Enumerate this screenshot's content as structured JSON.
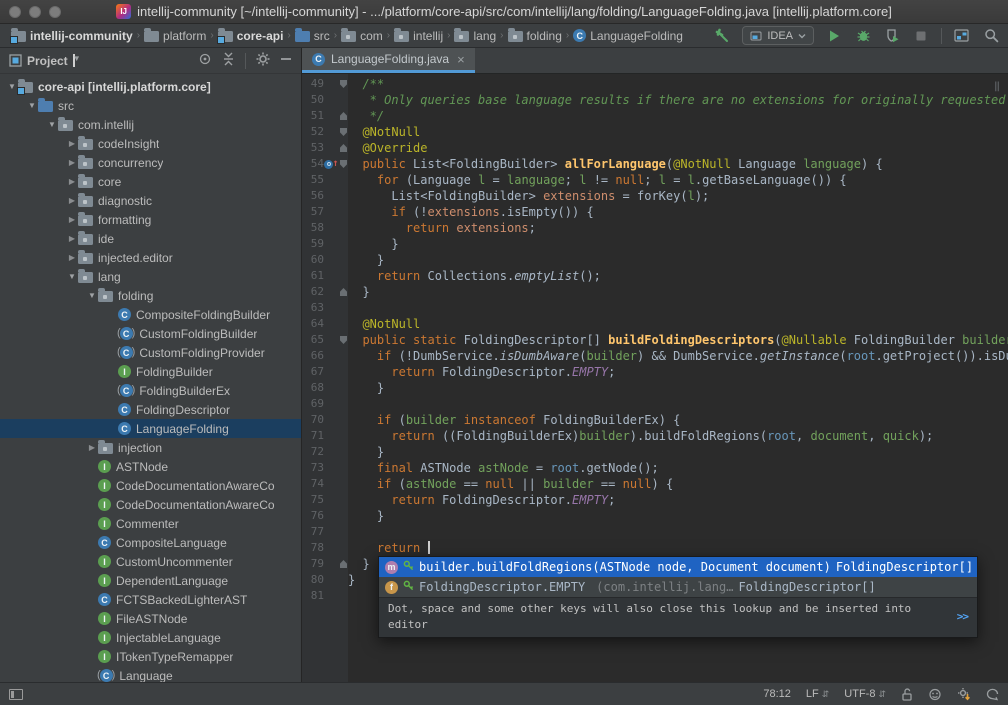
{
  "colors": {
    "editor_bg": "#2b2b2b",
    "panel_bg": "#3c3f41",
    "gutter_bg": "#313335",
    "tab_underline": "#529ad6",
    "tree_selection": "#1b3e5f",
    "popup_selection": "#1f63c2",
    "keyword": "#cc7832",
    "annotation": "#bbb529",
    "comment": "#629755",
    "method_decl": "#ffc66d",
    "run_green": "#59a869"
  },
  "title_bar": {
    "title": "intellij-community [~/intellij-community] - .../platform/core-api/src/com/intellij/lang/folding/LanguageFolding.java [intellij.platform.core]"
  },
  "toolbar": {
    "breadcrumbs": [
      {
        "label": "intellij-community",
        "icon": "module",
        "bold": true
      },
      {
        "label": "platform",
        "icon": "folder"
      },
      {
        "label": "core-api",
        "icon": "module",
        "bold": true
      },
      {
        "label": "src",
        "icon": "folder-src"
      },
      {
        "label": "com",
        "icon": "package"
      },
      {
        "label": "intellij",
        "icon": "package"
      },
      {
        "label": "lang",
        "icon": "package"
      },
      {
        "label": "folding",
        "icon": "package"
      },
      {
        "label": "LanguageFolding",
        "icon": "class"
      }
    ],
    "run_config": "IDEA",
    "action_icons": [
      "build-hammer",
      "run",
      "debug",
      "run-with-coverage",
      "stop",
      "project-structure",
      "search"
    ]
  },
  "project_panel": {
    "header": {
      "title": "Project",
      "icons": [
        "locate",
        "collapse-all",
        "settings-gear",
        "hide"
      ]
    },
    "tree": [
      {
        "label": "core-api [intellij.platform.core]",
        "level": 0,
        "icon": "module",
        "expand": "open",
        "bold": true
      },
      {
        "label": "src",
        "level": 1,
        "icon": "folder-src",
        "expand": "open"
      },
      {
        "label": "com.intellij",
        "level": 2,
        "icon": "package",
        "expand": "open"
      },
      {
        "label": "codeInsight",
        "level": 3,
        "icon": "package",
        "expand": "closed"
      },
      {
        "label": "concurrency",
        "level": 3,
        "icon": "package",
        "expand": "closed"
      },
      {
        "label": "core",
        "level": 3,
        "icon": "package",
        "expand": "closed"
      },
      {
        "label": "diagnostic",
        "level": 3,
        "icon": "package",
        "expand": "closed"
      },
      {
        "label": "formatting",
        "level": 3,
        "icon": "package",
        "expand": "closed"
      },
      {
        "label": "ide",
        "level": 3,
        "icon": "package",
        "expand": "closed"
      },
      {
        "label": "injected.editor",
        "level": 3,
        "icon": "package",
        "expand": "closed"
      },
      {
        "label": "lang",
        "level": 3,
        "icon": "package",
        "expand": "open"
      },
      {
        "label": "folding",
        "level": 4,
        "icon": "package",
        "expand": "open"
      },
      {
        "label": "CompositeFoldingBuilder",
        "level": 5,
        "icon": "class"
      },
      {
        "label": "CustomFoldingBuilder",
        "level": 5,
        "icon": "class-abstract"
      },
      {
        "label": "CustomFoldingProvider",
        "level": 5,
        "icon": "class-abstract"
      },
      {
        "label": "FoldingBuilder",
        "level": 5,
        "icon": "interface"
      },
      {
        "label": "FoldingBuilderEx",
        "level": 5,
        "icon": "class-abstract"
      },
      {
        "label": "FoldingDescriptor",
        "level": 5,
        "icon": "class"
      },
      {
        "label": "LanguageFolding",
        "level": 5,
        "icon": "class",
        "selected": true
      },
      {
        "label": "injection",
        "level": 4,
        "icon": "package",
        "expand": "closed"
      },
      {
        "label": "ASTNode",
        "level": 4,
        "icon": "interface"
      },
      {
        "label": "CodeDocumentationAwareCo",
        "level": 4,
        "icon": "interface"
      },
      {
        "label": "CodeDocumentationAwareCo",
        "level": 4,
        "icon": "interface"
      },
      {
        "label": "Commenter",
        "level": 4,
        "icon": "interface"
      },
      {
        "label": "CompositeLanguage",
        "level": 4,
        "icon": "class"
      },
      {
        "label": "CustomUncommenter",
        "level": 4,
        "icon": "interface"
      },
      {
        "label": "DependentLanguage",
        "level": 4,
        "icon": "interface"
      },
      {
        "label": "FCTSBackedLighterAST",
        "level": 4,
        "icon": "class"
      },
      {
        "label": "FileASTNode",
        "level": 4,
        "icon": "interface"
      },
      {
        "label": "InjectableLanguage",
        "level": 4,
        "icon": "interface"
      },
      {
        "label": "ITokenTypeRemapper",
        "level": 4,
        "icon": "interface"
      },
      {
        "label": "Language",
        "level": 4,
        "icon": "class-abstract"
      }
    ]
  },
  "editor": {
    "tab": {
      "label": "LanguageFolding.java",
      "icon": "class",
      "close": "×"
    },
    "lines": [
      {
        "n": 49,
        "f": "d",
        "s": [
          [
            "  /**",
            "c"
          ]
        ]
      },
      {
        "n": 50,
        "s": [
          [
            "   * Only queries base language results if there are no extensions for originally requested",
            "c"
          ]
        ]
      },
      {
        "n": 51,
        "f": "u",
        "s": [
          [
            "   */",
            "c"
          ]
        ]
      },
      {
        "n": 52,
        "f": "d",
        "s": [
          [
            "  ",
            "p"
          ],
          [
            "@NotNull",
            "a"
          ]
        ]
      },
      {
        "n": 53,
        "f": "u",
        "s": [
          [
            "  ",
            "p"
          ],
          [
            "@Override",
            "a"
          ]
        ]
      },
      {
        "n": 54,
        "f": "d",
        "g": "override",
        "s": [
          [
            "  ",
            "p"
          ],
          [
            "public",
            "k"
          ],
          [
            " List<FoldingBuilder> ",
            "p"
          ],
          [
            "allForLanguage",
            "m"
          ],
          [
            "(",
            "p"
          ],
          [
            "@NotNull",
            "a"
          ],
          [
            " Language ",
            "p"
          ],
          [
            "language",
            "v"
          ],
          [
            ") {",
            "p"
          ]
        ]
      },
      {
        "n": 55,
        "s": [
          [
            "    ",
            "p"
          ],
          [
            "for",
            "k"
          ],
          [
            " (Language ",
            "p"
          ],
          [
            "l",
            "v"
          ],
          [
            " = ",
            "p"
          ],
          [
            "language",
            "v"
          ],
          [
            "; ",
            "p"
          ],
          [
            "l",
            "v"
          ],
          [
            " != ",
            "p"
          ],
          [
            "null",
            "k"
          ],
          [
            "; ",
            "p"
          ],
          [
            "l",
            "v"
          ],
          [
            " = ",
            "p"
          ],
          [
            "l",
            "v"
          ],
          [
            ".getBaseLanguage()) {",
            "p"
          ]
        ]
      },
      {
        "n": 56,
        "s": [
          [
            "      List<FoldingBuilder> ",
            "p"
          ],
          [
            "extensions",
            "s"
          ],
          [
            " = forKey(",
            "p"
          ],
          [
            "l",
            "v"
          ],
          [
            ");",
            "p"
          ]
        ]
      },
      {
        "n": 57,
        "s": [
          [
            "      ",
            "p"
          ],
          [
            "if",
            "k"
          ],
          [
            " (!",
            "p"
          ],
          [
            "extensions",
            "s"
          ],
          [
            ".isEmpty()) {",
            "p"
          ]
        ]
      },
      {
        "n": 58,
        "s": [
          [
            "        ",
            "p"
          ],
          [
            "return",
            "k"
          ],
          [
            " ",
            "p"
          ],
          [
            "extensions",
            "s"
          ],
          [
            ";",
            "p"
          ]
        ]
      },
      {
        "n": 59,
        "s": [
          [
            "      }",
            "p"
          ]
        ]
      },
      {
        "n": 60,
        "s": [
          [
            "    }",
            "p"
          ]
        ]
      },
      {
        "n": 61,
        "s": [
          [
            "    ",
            "p"
          ],
          [
            "return",
            "k"
          ],
          [
            " Collections.",
            "p"
          ],
          [
            "emptyList",
            "i"
          ],
          [
            "();",
            "p"
          ]
        ]
      },
      {
        "n": 62,
        "f": "u",
        "s": [
          [
            "  }",
            "p"
          ]
        ]
      },
      {
        "n": 63,
        "s": []
      },
      {
        "n": 64,
        "s": [
          [
            "  ",
            "p"
          ],
          [
            "@NotNull",
            "a"
          ]
        ]
      },
      {
        "n": 65,
        "f": "d",
        "s": [
          [
            "  ",
            "p"
          ],
          [
            "public",
            "k"
          ],
          [
            " ",
            "p"
          ],
          [
            "static",
            "k"
          ],
          [
            " FoldingDescriptor[] ",
            "p"
          ],
          [
            "buildFoldingDescriptors",
            "m"
          ],
          [
            "(",
            "p"
          ],
          [
            "@Nullable",
            "a"
          ],
          [
            " FoldingBuilder ",
            "p"
          ],
          [
            "builder",
            "v"
          ],
          [
            ", ",
            "p"
          ]
        ]
      },
      {
        "n": 66,
        "s": [
          [
            "    ",
            "p"
          ],
          [
            "if",
            "k"
          ],
          [
            " (!DumbService.",
            "p"
          ],
          [
            "isDumbAware",
            "i"
          ],
          [
            "(",
            "p"
          ],
          [
            "builder",
            "v"
          ],
          [
            ") && DumbService.",
            "p"
          ],
          [
            "getInstance",
            "i"
          ],
          [
            "(",
            "p"
          ],
          [
            "root",
            "b"
          ],
          [
            ".getProject()).isDumb",
            "p"
          ]
        ]
      },
      {
        "n": 67,
        "s": [
          [
            "      ",
            "p"
          ],
          [
            "return",
            "k"
          ],
          [
            " FoldingDescriptor.",
            "p"
          ],
          [
            "EMPTY",
            "e"
          ],
          [
            ";",
            "p"
          ]
        ]
      },
      {
        "n": 68,
        "s": [
          [
            "    }",
            "p"
          ]
        ]
      },
      {
        "n": 69,
        "s": []
      },
      {
        "n": 70,
        "s": [
          [
            "    ",
            "p"
          ],
          [
            "if",
            "k"
          ],
          [
            " (",
            "p"
          ],
          [
            "builder",
            "v"
          ],
          [
            " ",
            "p"
          ],
          [
            "instanceof",
            "k"
          ],
          [
            " FoldingBuilderEx) {",
            "p"
          ]
        ]
      },
      {
        "n": 71,
        "s": [
          [
            "      ",
            "p"
          ],
          [
            "return",
            "k"
          ],
          [
            " ((FoldingBuilderEx)",
            "p"
          ],
          [
            "builder",
            "v"
          ],
          [
            ").buildFoldRegions(",
            "p"
          ],
          [
            "root",
            "b"
          ],
          [
            ", ",
            "p"
          ],
          [
            "document",
            "v"
          ],
          [
            ", ",
            "p"
          ],
          [
            "quick",
            "v"
          ],
          [
            ");",
            "p"
          ]
        ]
      },
      {
        "n": 72,
        "s": [
          [
            "    }",
            "p"
          ]
        ]
      },
      {
        "n": 73,
        "s": [
          [
            "    ",
            "p"
          ],
          [
            "final",
            "k"
          ],
          [
            " ASTNode ",
            "p"
          ],
          [
            "astNode",
            "v"
          ],
          [
            " = ",
            "p"
          ],
          [
            "root",
            "b"
          ],
          [
            ".getNode();",
            "p"
          ]
        ]
      },
      {
        "n": 74,
        "s": [
          [
            "    ",
            "p"
          ],
          [
            "if",
            "k"
          ],
          [
            " (",
            "p"
          ],
          [
            "astNode",
            "v"
          ],
          [
            " == ",
            "p"
          ],
          [
            "null",
            "k"
          ],
          [
            " || ",
            "p"
          ],
          [
            "builder",
            "v"
          ],
          [
            " == ",
            "p"
          ],
          [
            "null",
            "k"
          ],
          [
            ") {",
            "p"
          ]
        ]
      },
      {
        "n": 75,
        "s": [
          [
            "      ",
            "p"
          ],
          [
            "return",
            "k"
          ],
          [
            " FoldingDescriptor.",
            "p"
          ],
          [
            "EMPTY",
            "e"
          ],
          [
            ";",
            "p"
          ]
        ]
      },
      {
        "n": 76,
        "s": [
          [
            "    }",
            "p"
          ]
        ]
      },
      {
        "n": 77,
        "s": []
      },
      {
        "n": 78,
        "caret": true,
        "s": [
          [
            "    ",
            "p"
          ],
          [
            "return",
            "k"
          ],
          [
            " ",
            "p"
          ]
        ]
      },
      {
        "n": 79,
        "f": "u",
        "s": [
          [
            "  }",
            "p"
          ]
        ]
      },
      {
        "n": 80,
        "s": [
          [
            "}",
            "p"
          ]
        ]
      },
      {
        "n": 81,
        "s": []
      }
    ]
  },
  "completion_popup": {
    "items": [
      {
        "kind": "method",
        "name": "builder.buildFoldRegions(ASTNode node, Document document)",
        "tail": "FoldingDescriptor[]",
        "selected": true
      },
      {
        "kind": "field",
        "name": "FoldingDescriptor.EMPTY",
        "package": "(com.intellij.lang…",
        "tail": "FoldingDescriptor[]",
        "selected": false
      }
    ],
    "hint": "Dot, space and some other keys will also close this lookup and be inserted into editor",
    "hint_link": ">>"
  },
  "status_bar": {
    "caret_position": "78:12",
    "line_separator": "LF",
    "encoding": "UTF-8",
    "icons": [
      "toolwindow-switcher",
      "lock-open",
      "highlighting-level",
      "update-gear",
      "event-bubble"
    ]
  }
}
